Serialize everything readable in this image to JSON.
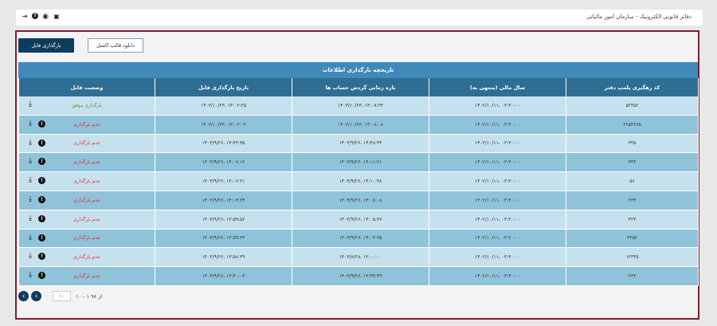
{
  "header": {
    "title": "دفاتر قانونی الکترونیک - سازمان امور مالیاتی",
    "icons": [
      "logout-icon",
      "help-icon",
      "eye-icon",
      "book-icon"
    ]
  },
  "toolbar": {
    "upload_label": "دانلود قالب اکسل",
    "download_label": "بارگذاری فایل"
  },
  "table": {
    "caption": "تاریخچه بارگذاری اطلاعات",
    "headers": {
      "code": "کد رهگیری پلمپ دفتر",
      "fiscal": "سال مالی (منتهی به)",
      "period": "بازه زمانی گردش حساب ها",
      "date": "تاریخ بارگذاری فایل",
      "status": "وضعیت فایل"
    },
    "rows": [
      {
        "code": "۵۲۳۵۲",
        "fiscal": "۱۴۰۲/۱۰/۱۱، ۰۳:۳۰:۰۰",
        "period": "۱۴۰۳/۱۰/۲۳، ۱۴:۰۷:۳۳",
        "date": "۱۴۰۳/۱۰/۲۳، ۱۴:۰۲:۲۵",
        "status": "بارگذاری موفق",
        "ok": true
      },
      {
        "code": "۴۶۵۴۶۶۵",
        "fiscal": "۱۴۰۲/۱۰/۱۱، ۰۳:۳۰:۰۰",
        "period": "۱۴۰۳/۱۰/۲۳، ۱۴:۰۸:۰۸",
        "date": "۱۴۰۳/۱۰/۲۳، ۱۴:۰۲:۰۲",
        "status": "عدم بارگذاری",
        "ok": false
      },
      {
        "code": "۳۴۵",
        "fiscal": "۱۴۰۲/۱۰/۱۱، ۰۳:۳۰:۰۰",
        "period": "۱۴۰۳/۹/۲۶، ۱۴:۴۸:۳۴",
        "date": "۱۴۰۳/۹/۲۶، ۱۴:۴۳:۴۵",
        "status": "عدم بارگذاری",
        "ok": false
      },
      {
        "code": "۳۳۴",
        "fiscal": "۱۴۰۲/۱۰/۱۱، ۰۳:۳۰:۰۰",
        "period": "۱۴۰۳/۹/۲۶، ۱۴:۱۱:۲۱",
        "date": "۱۴۰۳/۹/۲۶، ۱۴:۰۷:۱۲",
        "status": "عدم بارگذاری",
        "ok": false
      },
      {
        "code": "۵۶",
        "fiscal": "۱۴۰۲/۱۰/۱۱، ۰۳:۳۰:۰۰",
        "period": "۱۴۰۳/۹/۲۶، ۱۴:۱۰:۴۸",
        "date": "۱۴۰۳/۹/۲۶، ۱۴:۰۶:۲۱",
        "status": "عدم بارگذاری",
        "ok": false
      },
      {
        "code": "۲۳۴",
        "fiscal": "۱۴۰۲/۱۰/۱۱، ۰۳:۳۰:۰۰",
        "period": "۱۴۰۳/۹/۲۶، ۱۴:۰۸:۰۸",
        "date": "۱۴۰۳/۹/۲۶، ۱۴:۰۳:۲۴",
        "status": "عدم بارگذاری",
        "ok": false
      },
      {
        "code": "۳۲۴",
        "fiscal": "۱۴۰۲/۱۰/۱۱، ۰۳:۳۰:۰۰",
        "period": "۱۴۰۳/۹/۲۶، ۱۴:۰۵:۳۷",
        "date": "۱۴۰۳/۹/۲۶، ۱۳:۵۹:۵۶",
        "status": "عدم بارگذاری",
        "ok": false
      },
      {
        "code": "۳۴۵۶",
        "fiscal": "۱۴۰۲/۱۰/۱۱، ۰۳:۳۰:۰۰",
        "period": "۱۴۰۳/۹/۲۶، ۱۴:۰۳:۴۵",
        "date": "۱۴۰۳/۹/۲۶، ۱۳:۵۹:۳۳",
        "status": "عدم بارگذاری",
        "ok": false
      },
      {
        "code": "۱۲۳۴۵",
        "fiscal": "۱۴۰۲/۱۰/۱۱، ۰۳:۳۰:۰۰",
        "period": "۱۴۰۳/۸/۲۸، ۱۲:۰۰:۰۰",
        "date": "۱۴۰۳/۹/۲۶، ۱۳:۵۸:۳۹",
        "status": "عدم بارگذاری",
        "ok": false
      },
      {
        "code": "۲۳۴",
        "fiscal": "۱۴۰۲/۱۰/۱۱، ۰۳:۳۰:۰۰",
        "period": "۱۴۰۳/۹/۲۶، ۱۳:۴۴:۴۹",
        "date": "۱۴۰۳/۹/۲۶، ۱۳:۴۰:۰۳",
        "status": "عدم بارگذاری",
        "ok": false
      }
    ]
  },
  "pager": {
    "page_size": "۱۰",
    "range": "۱۰ - ۱ از ۹۸",
    "colors": {
      "accent": "#0c3d5e",
      "ok": "#4a9a3a",
      "fail": "#e0262e"
    }
  }
}
